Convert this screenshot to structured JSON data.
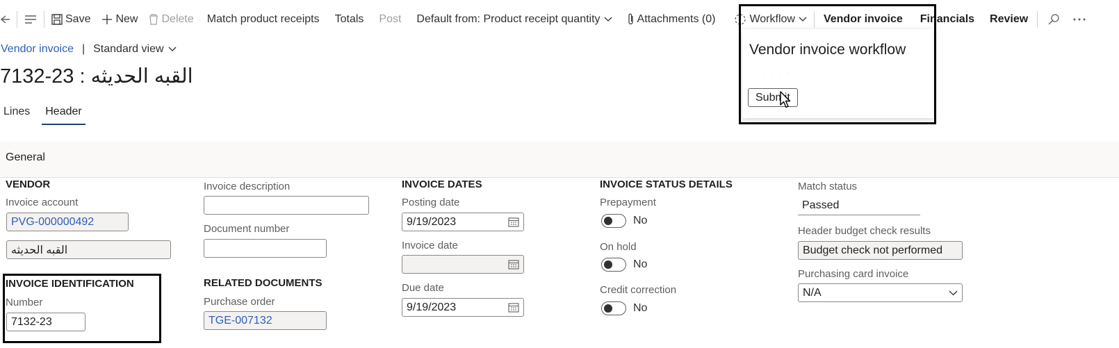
{
  "toolbar": {
    "save": "Save",
    "new": "New",
    "delete": "Delete",
    "match_receipts": "Match product receipts",
    "totals": "Totals",
    "post": "Post",
    "default_from": "Default from: Product receipt quantity",
    "attachments": "Attachments (0)",
    "workflow": "Workflow",
    "vendor_invoice": "Vendor invoice",
    "financials": "Financials",
    "review": "Review"
  },
  "breadcrumb": {
    "link": "Vendor invoice",
    "separator": "|",
    "view": "Standard view"
  },
  "page_title": "7132-23 : القبه الحديثه",
  "tabs": [
    "Lines",
    "Header"
  ],
  "section": {
    "title": "General"
  },
  "vendor": {
    "heading": "VENDOR",
    "invoice_account_label": "Invoice account",
    "invoice_account": "PVG-000000492",
    "vendor_name": "القبه الحديثه"
  },
  "invoice_identification": {
    "heading": "INVOICE IDENTIFICATION",
    "number_label": "Number",
    "number": "7132-23"
  },
  "misc": {
    "invoice_description_label": "Invoice description",
    "invoice_description": "",
    "document_number_label": "Document number",
    "document_number": ""
  },
  "related": {
    "heading": "RELATED DOCUMENTS",
    "purchase_order_label": "Purchase order",
    "purchase_order": "TGE-007132"
  },
  "dates": {
    "heading": "INVOICE DATES",
    "posting_label": "Posting date",
    "posting": "9/19/2023",
    "invoice_label": "Invoice date",
    "invoice": "",
    "due_label": "Due date",
    "due": "9/19/2023"
  },
  "status": {
    "heading": "INVOICE STATUS DETAILS",
    "prepayment_label": "Prepayment",
    "prepayment": "No",
    "on_hold_label": "On hold",
    "on_hold": "No",
    "credit_label": "Credit correction",
    "credit": "No"
  },
  "match": {
    "match_status_label": "Match status",
    "match_status": "Passed",
    "budget_label": "Header budget check results",
    "budget": "Budget check not performed",
    "pcard_label": "Purchasing card invoice",
    "pcard": "N/A"
  },
  "workflow_popup": {
    "title": "Vendor invoice workflow",
    "submit": "Submit"
  },
  "colors": {
    "link": "#2f5eb8",
    "accent": "#1f3f77",
    "highlight_box": "#000000"
  }
}
